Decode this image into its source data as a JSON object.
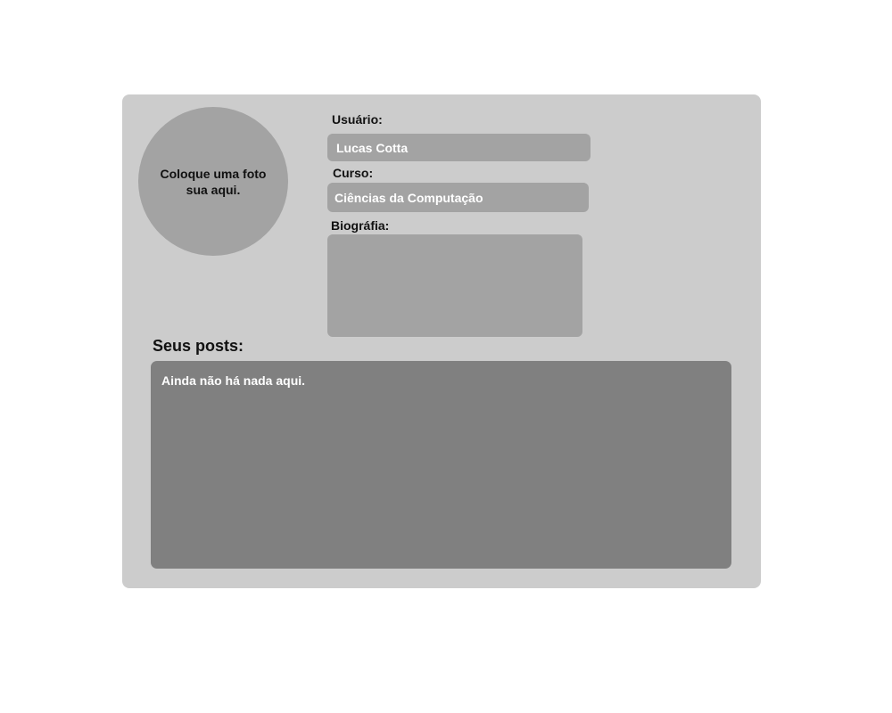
{
  "profile": {
    "photo_placeholder": "Coloque uma foto sua aqui.",
    "user_label": "Usuário:",
    "user_value": "Lucas Cotta",
    "course_label": "Curso:",
    "course_value": "Ciências da Computação",
    "bio_label": "Biográfia:",
    "bio_value": ""
  },
  "posts": {
    "title": "Seus posts:",
    "empty_message": "Ainda não há nada aqui."
  },
  "colors": {
    "page_background": "#ffffff",
    "card_background": "#cccccc",
    "field_background": "#a3a3a3",
    "posts_background": "#808080"
  }
}
